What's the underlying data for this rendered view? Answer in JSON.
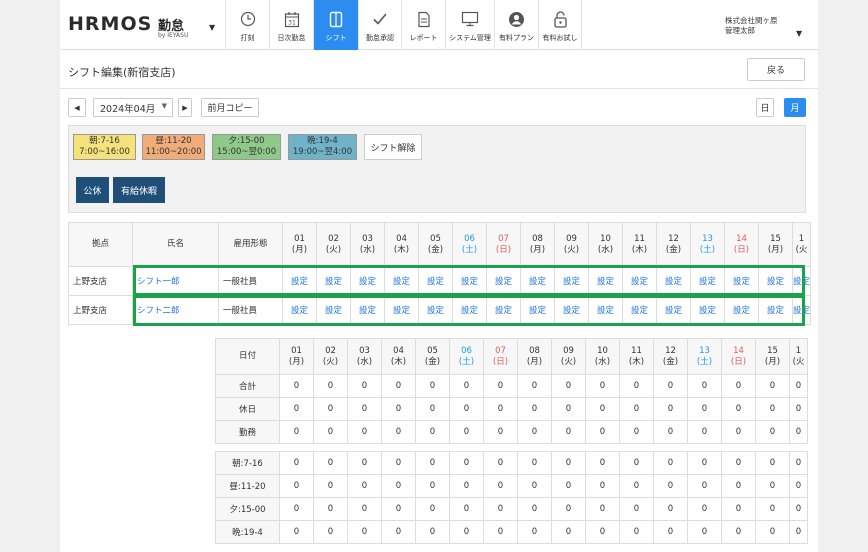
{
  "header": {
    "logo": "HRMOS",
    "logo_kintai": "勤怠",
    "logo_by": "by IEYASU",
    "nav": [
      {
        "label": "打刻",
        "icon": "clock-icon",
        "active": false
      },
      {
        "label": "日次勤怠",
        "icon": "calendar-31-icon",
        "active": false
      },
      {
        "label": "シフト",
        "icon": "shift-book-icon",
        "active": true
      },
      {
        "label": "勤怠承認",
        "icon": "checkmark-icon",
        "active": false
      },
      {
        "label": "レポート",
        "icon": "report-document-icon",
        "active": false
      },
      {
        "label": "システム管理",
        "icon": "monitor-icon",
        "active": false
      },
      {
        "label": "有料プラン",
        "icon": "user-circle-icon",
        "active": false
      },
      {
        "label": "有料お試し",
        "icon": "unlock-icon",
        "active": false
      }
    ],
    "company": "株式会社関ヶ原",
    "user": "管理太郎"
  },
  "page": {
    "title": "シフト編集(新宿支店)",
    "back_label": "戻る",
    "month": "2024年04月",
    "copy_prev_label": "前月コピー",
    "day_view_label": "日",
    "month_view_label": "月"
  },
  "shifts": [
    {
      "name": "朝:7-16",
      "time": "7:00~16:00",
      "color": "#f5e27a"
    },
    {
      "name": "昼:11-20",
      "time": "11:00~20:00",
      "color": "#f0ad7a"
    },
    {
      "name": "夕:15-00",
      "time": "15:00~翌0:00",
      "color": "#8fc98a"
    },
    {
      "name": "晩:19-4",
      "time": "19:00~翌4:00",
      "color": "#6fb3c9"
    }
  ],
  "shift_clear_label": "シフト解除",
  "leave_buttons": [
    "公休",
    "有給休暇"
  ],
  "table": {
    "headers": {
      "base": "拠点",
      "name": "氏名",
      "type": "雇用形態"
    },
    "days": [
      {
        "num": "01",
        "dow": "(月)",
        "kind": ""
      },
      {
        "num": "02",
        "dow": "(火)",
        "kind": ""
      },
      {
        "num": "03",
        "dow": "(水)",
        "kind": ""
      },
      {
        "num": "04",
        "dow": "(木)",
        "kind": ""
      },
      {
        "num": "05",
        "dow": "(金)",
        "kind": ""
      },
      {
        "num": "06",
        "dow": "(土)",
        "kind": "sat"
      },
      {
        "num": "07",
        "dow": "(日)",
        "kind": "sun"
      },
      {
        "num": "08",
        "dow": "(月)",
        "kind": ""
      },
      {
        "num": "09",
        "dow": "(火)",
        "kind": ""
      },
      {
        "num": "10",
        "dow": "(水)",
        "kind": ""
      },
      {
        "num": "11",
        "dow": "(木)",
        "kind": ""
      },
      {
        "num": "12",
        "dow": "(金)",
        "kind": ""
      },
      {
        "num": "13",
        "dow": "(土)",
        "kind": "sat"
      },
      {
        "num": "14",
        "dow": "(日)",
        "kind": "sun"
      },
      {
        "num": "15",
        "dow": "(月)",
        "kind": ""
      },
      {
        "num": "1",
        "dow": "(火",
        "kind": ""
      }
    ],
    "cell_label": "設定",
    "rows": [
      {
        "base": "上野支店",
        "name": "シフト一郎",
        "type": "一般社員"
      },
      {
        "base": "上野支店",
        "name": "シフト二郎",
        "type": "一般社員"
      }
    ]
  },
  "summary": {
    "date_label": "日付",
    "groups": [
      [
        "合計",
        "休日",
        "勤務"
      ],
      [
        "朝:7-16",
        "昼:11-20",
        "夕:15-00",
        "晩:19-4"
      ]
    ],
    "value": "0"
  }
}
